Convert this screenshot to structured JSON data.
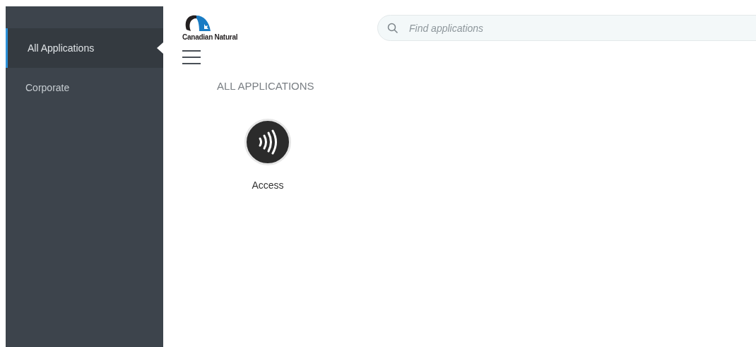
{
  "sidebar": {
    "items": [
      {
        "label": "All Applications",
        "selected": true
      },
      {
        "label": "Corporate",
        "selected": false
      }
    ]
  },
  "logo": {
    "text": "Canadian Natural"
  },
  "search": {
    "placeholder": "Find applications"
  },
  "section_title": "ALL APPLICATIONS",
  "apps": [
    {
      "label": "Access"
    }
  ]
}
